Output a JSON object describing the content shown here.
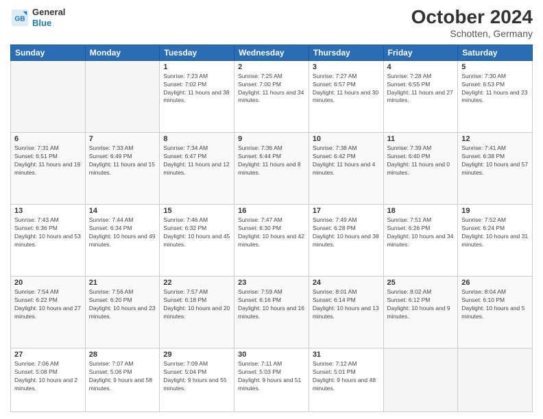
{
  "header": {
    "logo": {
      "line1": "General",
      "line2": "Blue"
    },
    "title": "October 2024",
    "subtitle": "Schotten, Germany"
  },
  "weekdays": [
    "Sunday",
    "Monday",
    "Tuesday",
    "Wednesday",
    "Thursday",
    "Friday",
    "Saturday"
  ],
  "weeks": [
    [
      {
        "day": null
      },
      {
        "day": null
      },
      {
        "day": "1",
        "sunrise": "Sunrise: 7:23 AM",
        "sunset": "Sunset: 7:02 PM",
        "daylight": "Daylight: 11 hours and 38 minutes."
      },
      {
        "day": "2",
        "sunrise": "Sunrise: 7:25 AM",
        "sunset": "Sunset: 7:00 PM",
        "daylight": "Daylight: 11 hours and 34 minutes."
      },
      {
        "day": "3",
        "sunrise": "Sunrise: 7:27 AM",
        "sunset": "Sunset: 6:57 PM",
        "daylight": "Daylight: 11 hours and 30 minutes."
      },
      {
        "day": "4",
        "sunrise": "Sunrise: 7:28 AM",
        "sunset": "Sunset: 6:55 PM",
        "daylight": "Daylight: 11 hours and 27 minutes."
      },
      {
        "day": "5",
        "sunrise": "Sunrise: 7:30 AM",
        "sunset": "Sunset: 6:53 PM",
        "daylight": "Daylight: 11 hours and 23 minutes."
      }
    ],
    [
      {
        "day": "6",
        "sunrise": "Sunrise: 7:31 AM",
        "sunset": "Sunset: 6:51 PM",
        "daylight": "Daylight: 11 hours and 19 minutes."
      },
      {
        "day": "7",
        "sunrise": "Sunrise: 7:33 AM",
        "sunset": "Sunset: 6:49 PM",
        "daylight": "Daylight: 11 hours and 15 minutes."
      },
      {
        "day": "8",
        "sunrise": "Sunrise: 7:34 AM",
        "sunset": "Sunset: 6:47 PM",
        "daylight": "Daylight: 11 hours and 12 minutes."
      },
      {
        "day": "9",
        "sunrise": "Sunrise: 7:36 AM",
        "sunset": "Sunset: 6:44 PM",
        "daylight": "Daylight: 11 hours and 8 minutes."
      },
      {
        "day": "10",
        "sunrise": "Sunrise: 7:38 AM",
        "sunset": "Sunset: 6:42 PM",
        "daylight": "Daylight: 11 hours and 4 minutes."
      },
      {
        "day": "11",
        "sunrise": "Sunrise: 7:39 AM",
        "sunset": "Sunset: 6:40 PM",
        "daylight": "Daylight: 11 hours and 0 minutes."
      },
      {
        "day": "12",
        "sunrise": "Sunrise: 7:41 AM",
        "sunset": "Sunset: 6:38 PM",
        "daylight": "Daylight: 10 hours and 57 minutes."
      }
    ],
    [
      {
        "day": "13",
        "sunrise": "Sunrise: 7:43 AM",
        "sunset": "Sunset: 6:36 PM",
        "daylight": "Daylight: 10 hours and 53 minutes."
      },
      {
        "day": "14",
        "sunrise": "Sunrise: 7:44 AM",
        "sunset": "Sunset: 6:34 PM",
        "daylight": "Daylight: 10 hours and 49 minutes."
      },
      {
        "day": "15",
        "sunrise": "Sunrise: 7:46 AM",
        "sunset": "Sunset: 6:32 PM",
        "daylight": "Daylight: 10 hours and 45 minutes."
      },
      {
        "day": "16",
        "sunrise": "Sunrise: 7:47 AM",
        "sunset": "Sunset: 6:30 PM",
        "daylight": "Daylight: 10 hours and 42 minutes."
      },
      {
        "day": "17",
        "sunrise": "Sunrise: 7:49 AM",
        "sunset": "Sunset: 6:28 PM",
        "daylight": "Daylight: 10 hours and 38 minutes."
      },
      {
        "day": "18",
        "sunrise": "Sunrise: 7:51 AM",
        "sunset": "Sunset: 6:26 PM",
        "daylight": "Daylight: 10 hours and 34 minutes."
      },
      {
        "day": "19",
        "sunrise": "Sunrise: 7:52 AM",
        "sunset": "Sunset: 6:24 PM",
        "daylight": "Daylight: 10 hours and 31 minutes."
      }
    ],
    [
      {
        "day": "20",
        "sunrise": "Sunrise: 7:54 AM",
        "sunset": "Sunset: 6:22 PM",
        "daylight": "Daylight: 10 hours and 27 minutes."
      },
      {
        "day": "21",
        "sunrise": "Sunrise: 7:56 AM",
        "sunset": "Sunset: 6:20 PM",
        "daylight": "Daylight: 10 hours and 23 minutes."
      },
      {
        "day": "22",
        "sunrise": "Sunrise: 7:57 AM",
        "sunset": "Sunset: 6:18 PM",
        "daylight": "Daylight: 10 hours and 20 minutes."
      },
      {
        "day": "23",
        "sunrise": "Sunrise: 7:59 AM",
        "sunset": "Sunset: 6:16 PM",
        "daylight": "Daylight: 10 hours and 16 minutes."
      },
      {
        "day": "24",
        "sunrise": "Sunrise: 8:01 AM",
        "sunset": "Sunset: 6:14 PM",
        "daylight": "Daylight: 10 hours and 13 minutes."
      },
      {
        "day": "25",
        "sunrise": "Sunrise: 8:02 AM",
        "sunset": "Sunset: 6:12 PM",
        "daylight": "Daylight: 10 hours and 9 minutes."
      },
      {
        "day": "26",
        "sunrise": "Sunrise: 8:04 AM",
        "sunset": "Sunset: 6:10 PM",
        "daylight": "Daylight: 10 hours and 5 minutes."
      }
    ],
    [
      {
        "day": "27",
        "sunrise": "Sunrise: 7:06 AM",
        "sunset": "Sunset: 5:08 PM",
        "daylight": "Daylight: 10 hours and 2 minutes."
      },
      {
        "day": "28",
        "sunrise": "Sunrise: 7:07 AM",
        "sunset": "Sunset: 5:06 PM",
        "daylight": "Daylight: 9 hours and 58 minutes."
      },
      {
        "day": "29",
        "sunrise": "Sunrise: 7:09 AM",
        "sunset": "Sunset: 5:04 PM",
        "daylight": "Daylight: 9 hours and 55 minutes."
      },
      {
        "day": "30",
        "sunrise": "Sunrise: 7:11 AM",
        "sunset": "Sunset: 5:03 PM",
        "daylight": "Daylight: 9 hours and 51 minutes."
      },
      {
        "day": "31",
        "sunrise": "Sunrise: 7:12 AM",
        "sunset": "Sunset: 5:01 PM",
        "daylight": "Daylight: 9 hours and 48 minutes."
      },
      {
        "day": null
      },
      {
        "day": null
      }
    ]
  ]
}
